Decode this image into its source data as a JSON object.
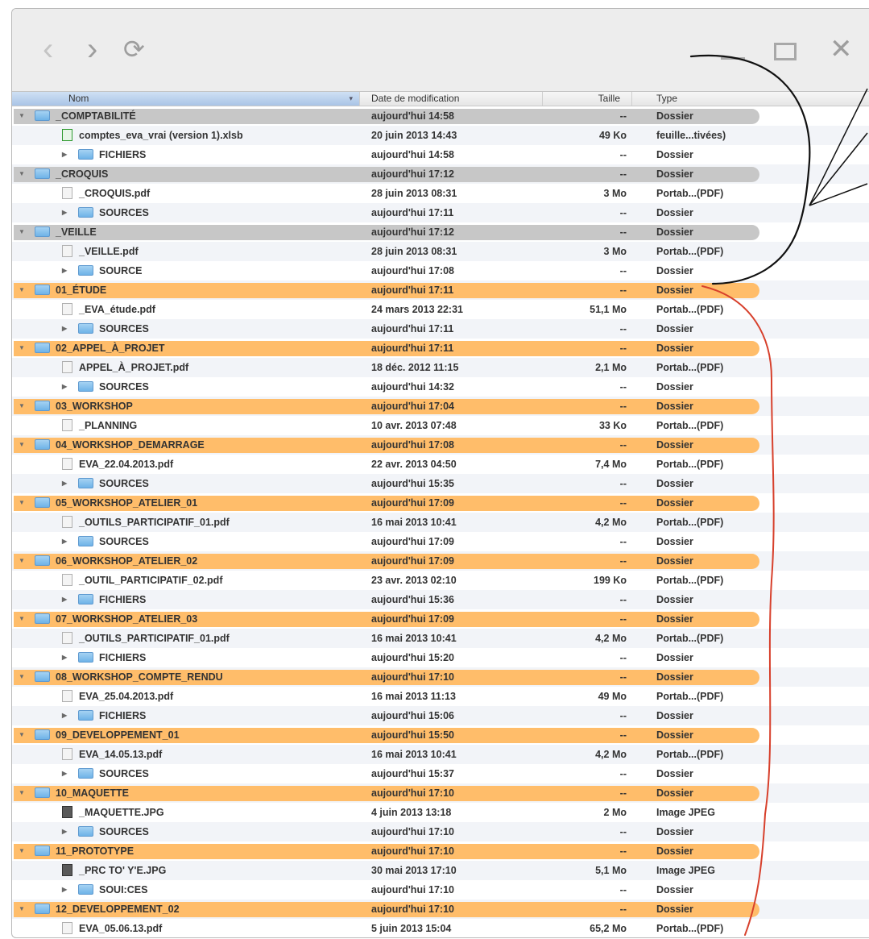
{
  "toolbar": {
    "back_icon": "chevron-left-icon",
    "forward_icon": "chevron-right-icon",
    "reload_icon": "reload-icon",
    "minimize_icon": "minimize-icon",
    "maximize_icon": "maximize-icon",
    "close_icon": "close-icon"
  },
  "columns": {
    "name": "Nom",
    "date": "Date de modification",
    "size": "Taille",
    "type": "Type"
  },
  "colors": {
    "gray_highlight": "#c7c7c7",
    "orange_highlight": "#ffbd6a",
    "red_annotation": "#d7402c"
  },
  "rows": [
    {
      "kind": "folder",
      "level": 0,
      "hl": "gray",
      "name": "_COMPTABILITÉ",
      "date": "aujourd'hui 14:58",
      "size": "--",
      "type": "Dossier"
    },
    {
      "kind": "file",
      "icon": "xls",
      "level": 1,
      "name": "comptes_eva_vrai (version 1).xlsb",
      "date": "20 juin 2013 14:43",
      "size": "49 Ko",
      "type": "feuille...tivées)"
    },
    {
      "kind": "folder",
      "level": 1,
      "name": "FICHIERS",
      "date": "aujourd'hui 14:58",
      "size": "--",
      "type": "Dossier"
    },
    {
      "kind": "folder",
      "level": 0,
      "hl": "gray",
      "name": "_CROQUIS",
      "date": "aujourd'hui 17:12",
      "size": "--",
      "type": "Dossier"
    },
    {
      "kind": "file",
      "icon": "pdf",
      "level": 1,
      "name": "_CROQUIS.pdf",
      "date": "28 juin 2013 08:31",
      "size": "3 Mo",
      "type": "Portab...(PDF)"
    },
    {
      "kind": "folder",
      "level": 1,
      "name": "SOURCES",
      "date": "aujourd'hui 17:11",
      "size": "--",
      "type": "Dossier"
    },
    {
      "kind": "folder",
      "level": 0,
      "hl": "gray",
      "name": "_VEILLE",
      "date": "aujourd'hui 17:12",
      "size": "--",
      "type": "Dossier"
    },
    {
      "kind": "file",
      "icon": "pdf",
      "level": 1,
      "name": "_VEILLE.pdf",
      "date": "28 juin 2013 08:31",
      "size": "3 Mo",
      "type": "Portab...(PDF)"
    },
    {
      "kind": "folder",
      "level": 1,
      "name": "SOURCE",
      "date": "aujourd'hui 17:08",
      "size": "--",
      "type": "Dossier"
    },
    {
      "kind": "folder",
      "level": 0,
      "hl": "orange",
      "name": "01_ÉTUDE",
      "date": "aujourd'hui 17:11",
      "size": "--",
      "type": "Dossier"
    },
    {
      "kind": "file",
      "icon": "pdf",
      "level": 1,
      "name": "_EVA_étude.pdf",
      "date": "24 mars 2013 22:31",
      "size": "51,1 Mo",
      "type": "Portab...(PDF)"
    },
    {
      "kind": "folder",
      "level": 1,
      "name": "SOURCES",
      "date": "aujourd'hui 17:11",
      "size": "--",
      "type": "Dossier"
    },
    {
      "kind": "folder",
      "level": 0,
      "hl": "orange",
      "name": "02_APPEL_À_PROJET",
      "date": "aujourd'hui 17:11",
      "size": "--",
      "type": "Dossier"
    },
    {
      "kind": "file",
      "icon": "pdf",
      "level": 1,
      "name": "APPEL_À_PROJET.pdf",
      "date": "18 déc. 2012 11:15",
      "size": "2,1 Mo",
      "type": "Portab...(PDF)"
    },
    {
      "kind": "folder",
      "level": 1,
      "name": "SOURCES",
      "date": "aujourd'hui 14:32",
      "size": "--",
      "type": "Dossier"
    },
    {
      "kind": "folder",
      "level": 0,
      "hl": "orange",
      "name": "03_WORKSHOP",
      "date": "aujourd'hui 17:04",
      "size": "--",
      "type": "Dossier"
    },
    {
      "kind": "file",
      "icon": "pdf",
      "level": 1,
      "name": "_PLANNING",
      "date": "10 avr. 2013 07:48",
      "size": "33 Ko",
      "type": "Portab...(PDF)"
    },
    {
      "kind": "folder",
      "level": 0,
      "hl": "orange",
      "name": "04_WORKSHOP_DEMARRAGE",
      "date": "aujourd'hui 17:08",
      "size": "--",
      "type": "Dossier"
    },
    {
      "kind": "file",
      "icon": "pdf",
      "level": 1,
      "name": "EVA_22.04.2013.pdf",
      "date": "22 avr. 2013 04:50",
      "size": "7,4 Mo",
      "type": "Portab...(PDF)"
    },
    {
      "kind": "folder",
      "level": 1,
      "name": "SOURCES",
      "date": "aujourd'hui 15:35",
      "size": "--",
      "type": "Dossier"
    },
    {
      "kind": "folder",
      "level": 0,
      "hl": "orange",
      "name": "05_WORKSHOP_ATELIER_01",
      "date": "aujourd'hui 17:09",
      "size": "--",
      "type": "Dossier"
    },
    {
      "kind": "file",
      "icon": "pdf",
      "level": 1,
      "name": "_OUTILS_PARTICIPATIF_01.pdf",
      "date": "16 mai 2013 10:41",
      "size": "4,2 Mo",
      "type": "Portab...(PDF)"
    },
    {
      "kind": "folder",
      "level": 1,
      "name": "SOURCES",
      "date": "aujourd'hui 17:09",
      "size": "--",
      "type": "Dossier"
    },
    {
      "kind": "folder",
      "level": 0,
      "hl": "orange",
      "name": "06_WORKSHOP_ATELIER_02",
      "date": "aujourd'hui 17:09",
      "size": "--",
      "type": "Dossier"
    },
    {
      "kind": "file",
      "icon": "pdf",
      "level": 1,
      "name": "_OUTIL_PARTICIPATIF_02.pdf",
      "date": "23 avr. 2013 02:10",
      "size": "199 Ko",
      "type": "Portab...(PDF)"
    },
    {
      "kind": "folder",
      "level": 1,
      "name": "FICHIERS",
      "date": "aujourd'hui 15:36",
      "size": "--",
      "type": "Dossier"
    },
    {
      "kind": "folder",
      "level": 0,
      "hl": "orange",
      "name": "07_WORKSHOP_ATELIER_03",
      "date": "aujourd'hui 17:09",
      "size": "--",
      "type": "Dossier"
    },
    {
      "kind": "file",
      "icon": "pdf",
      "level": 1,
      "name": "_OUTILS_PARTICIPATIF_01.pdf",
      "date": "16 mai 2013 10:41",
      "size": "4,2 Mo",
      "type": "Portab...(PDF)"
    },
    {
      "kind": "folder",
      "level": 1,
      "name": "FICHIERS",
      "date": "aujourd'hui 15:20",
      "size": "--",
      "type": "Dossier"
    },
    {
      "kind": "folder",
      "level": 0,
      "hl": "orange",
      "name": "08_WORKSHOP_COMPTE_RENDU",
      "date": "aujourd'hui 17:10",
      "size": "--",
      "type": "Dossier"
    },
    {
      "kind": "file",
      "icon": "pdf",
      "level": 1,
      "name": "EVA_25.04.2013.pdf",
      "date": "16 mai 2013 11:13",
      "size": "49 Mo",
      "type": "Portab...(PDF)"
    },
    {
      "kind": "folder",
      "level": 1,
      "name": "FICHIERS",
      "date": "aujourd'hui 15:06",
      "size": "--",
      "type": "Dossier"
    },
    {
      "kind": "folder",
      "level": 0,
      "hl": "orange",
      "name": "09_DEVELOPPEMENT_01",
      "date": "aujourd'hui 15:50",
      "size": "--",
      "type": "Dossier"
    },
    {
      "kind": "file",
      "icon": "pdf",
      "level": 1,
      "name": "EVA_14.05.13.pdf",
      "date": "16 mai 2013 10:41",
      "size": "4,2 Mo",
      "type": "Portab...(PDF)"
    },
    {
      "kind": "folder",
      "level": 1,
      "name": "SOURCES",
      "date": "aujourd'hui 15:37",
      "size": "--",
      "type": "Dossier"
    },
    {
      "kind": "folder",
      "level": 0,
      "hl": "orange",
      "name": "10_MAQUETTE",
      "date": "aujourd'hui 17:10",
      "size": "--",
      "type": "Dossier"
    },
    {
      "kind": "file",
      "icon": "img",
      "level": 1,
      "name": "_MAQUETTE.JPG",
      "date": "4 juin 2013 13:18",
      "size": "2 Mo",
      "type": "Image JPEG"
    },
    {
      "kind": "folder",
      "level": 1,
      "name": "SOURCES",
      "date": "aujourd'hui 17:10",
      "size": "--",
      "type": "Dossier"
    },
    {
      "kind": "folder",
      "level": 0,
      "hl": "orange",
      "name": "11_PROTOTYPE",
      "date": "aujourd'hui 17:10",
      "size": "--",
      "type": "Dossier"
    },
    {
      "kind": "file",
      "icon": "img",
      "level": 1,
      "name": "_PRC TO' Y'E.JPG",
      "date": "30 mai 2013 17:10",
      "size": "5,1 Mo",
      "type": "Image JPEG"
    },
    {
      "kind": "folder",
      "level": 1,
      "name": "SOUI:CES",
      "date": "aujourd'hui 17:10",
      "size": "--",
      "type": "Dossier"
    },
    {
      "kind": "folder",
      "level": 0,
      "hl": "orange",
      "name": "12_DEVELOPPEMENT_02",
      "date": "aujourd'hui 17:10",
      "size": "--",
      "type": "Dossier"
    },
    {
      "kind": "file",
      "icon": "pdf",
      "level": 1,
      "name": "EVA_05.06.13.pdf",
      "date": "5 juin 2013 15:04",
      "size": "65,2 Mo",
      "type": "Portab...(PDF)"
    }
  ]
}
